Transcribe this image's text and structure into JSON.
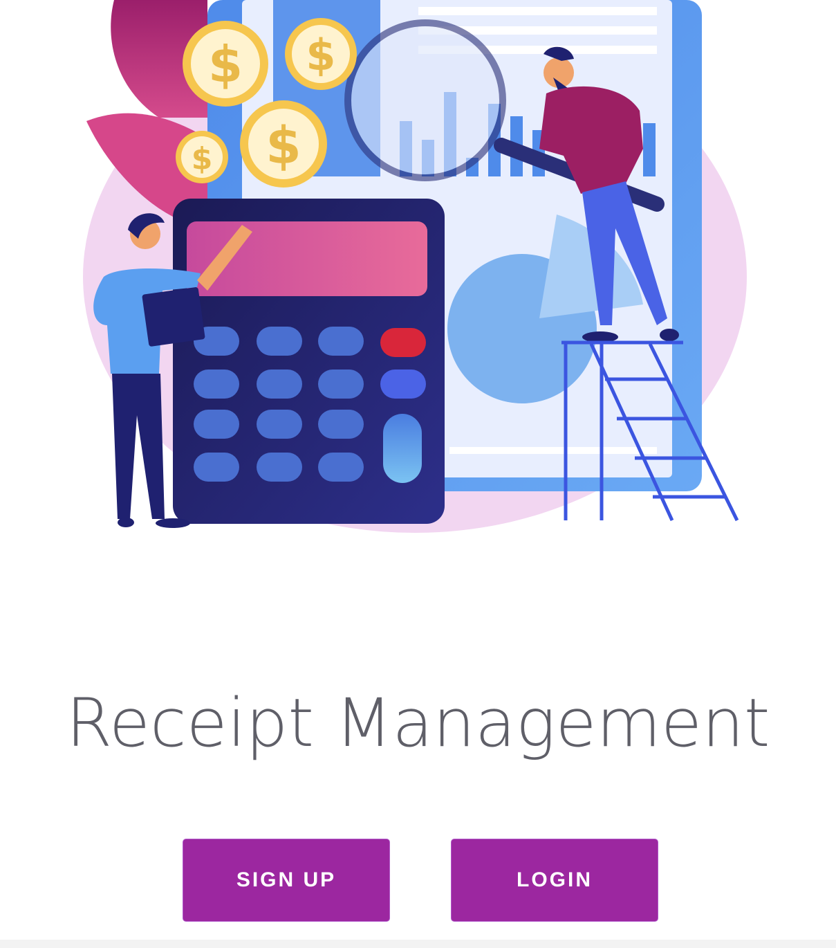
{
  "hero": {
    "illustration_icon": "finance-analysis-illustration",
    "coin_symbol": "$"
  },
  "title": "Receipt Management",
  "actions": {
    "signup_label": "SIGN UP",
    "login_label": "LOGIN"
  },
  "colors": {
    "primary": "#9c27a0",
    "title_text": "#5f5f68",
    "background": "#ffffff"
  }
}
